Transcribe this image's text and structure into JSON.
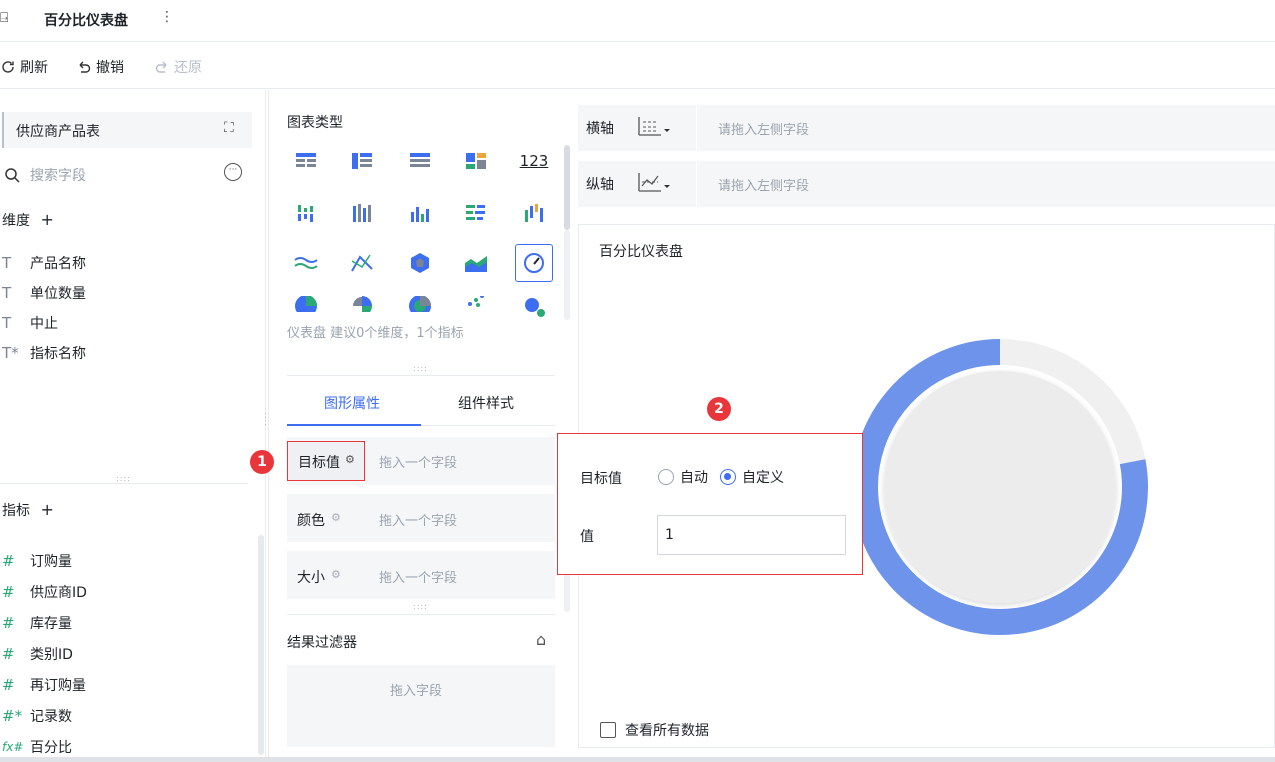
{
  "window": {
    "title": "百分比仪表盘",
    "more": "⋮"
  },
  "toolbar": {
    "refresh": "刷新",
    "undo": "撤销",
    "redo": "还原"
  },
  "left": {
    "dataset": "供应商产品表",
    "search_placeholder": "搜索字段",
    "dimension_label": "维度",
    "dimension_add": "+",
    "dimensions": [
      {
        "icon": "T",
        "name": "产品名称"
      },
      {
        "icon": "T",
        "name": "单位数量"
      },
      {
        "icon": "T",
        "name": "中止"
      },
      {
        "icon": "T*",
        "name": "指标名称"
      }
    ],
    "metric_label": "指标",
    "metric_add": "+",
    "metrics": [
      {
        "icon": "#",
        "name": "订购量"
      },
      {
        "icon": "#",
        "name": "供应商ID"
      },
      {
        "icon": "#",
        "name": "库存量"
      },
      {
        "icon": "#",
        "name": "类别ID"
      },
      {
        "icon": "#",
        "name": "再订购量"
      },
      {
        "icon": "#*",
        "name": "记录数"
      },
      {
        "icon": "fx#",
        "name": "百分比"
      }
    ]
  },
  "middle": {
    "chart_type_label": "图表类型",
    "chart_hint": "仪表盘 建议0个维度，1个指标",
    "tab_props": "图形属性",
    "tab_style": "组件样式",
    "target_label": "目标值",
    "color_label": "颜色",
    "size_label": "大小",
    "drop_placeholder": "拖入一个字段",
    "filter_label": "结果过滤器",
    "filter_placeholder": "拖入字段",
    "number_icon_text": "123"
  },
  "right": {
    "x_axis_label": "横轴",
    "y_axis_label": "纵轴",
    "axis_placeholder": "请拖入左侧字段",
    "chart_title": "百分比仪表盘",
    "view_all": "查看所有数据",
    "gauge_fraction": 0.78
  },
  "popup": {
    "target_label": "目标值",
    "auto_label": "自动",
    "custom_label": "自定义",
    "value_label": "值",
    "value": "1"
  },
  "badges": {
    "one": "1",
    "two": "2"
  },
  "colors": {
    "accent": "#3d6df0",
    "gauge_fill": "#6d93ea",
    "gauge_track": "#f0f0f0",
    "badge": "#e8363a"
  }
}
